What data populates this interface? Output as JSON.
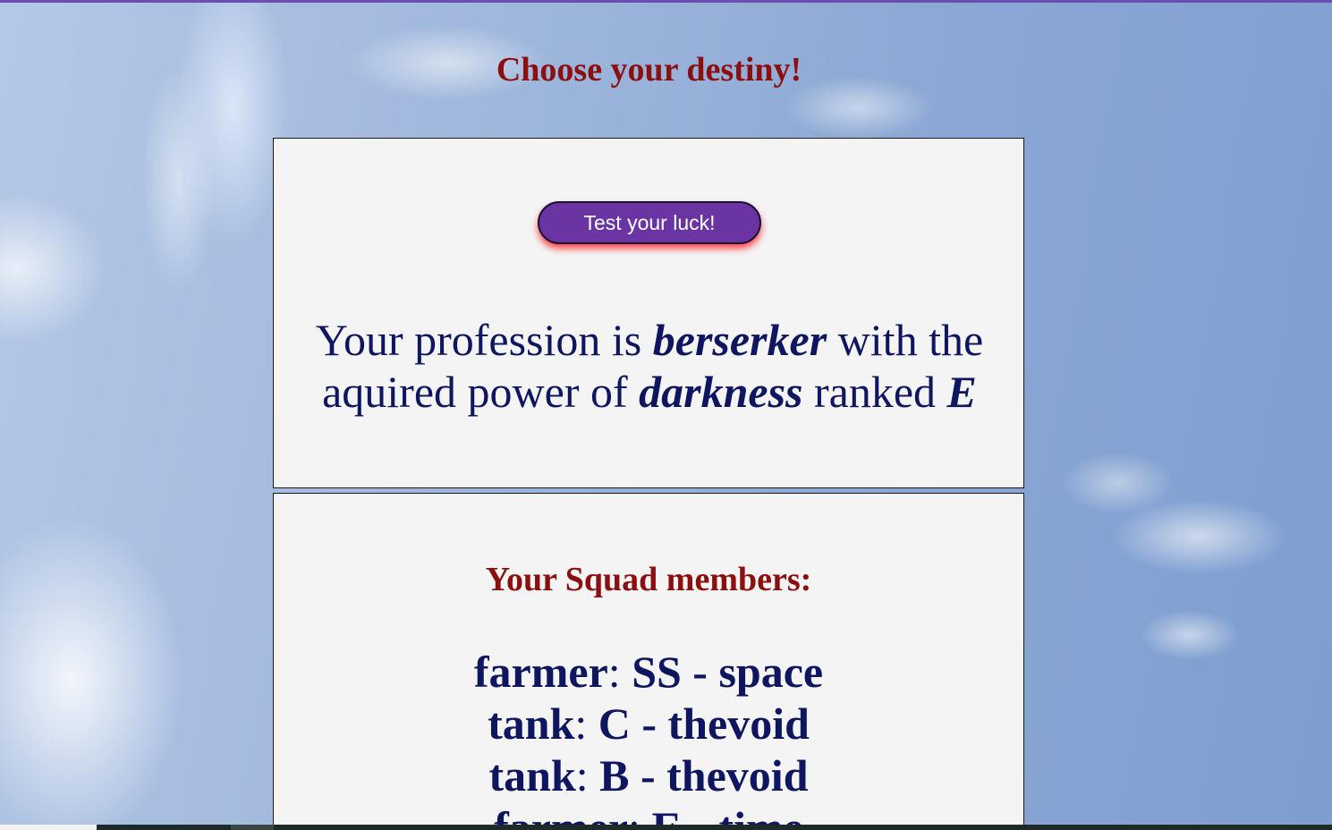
{
  "page": {
    "title": "Choose your destiny!"
  },
  "luck_panel": {
    "button_label": "Test your luck!",
    "result": {
      "prefix": "Your profession is ",
      "profession": "berserker",
      "middle": " with the aquired power of ",
      "power": "darkness",
      "rank_label": " ranked ",
      "rank": "E"
    }
  },
  "squad_panel": {
    "heading": "Your Squad members:",
    "members": [
      {
        "profession": "farmer",
        "separator": ": ",
        "detail": "SS - space"
      },
      {
        "profession": "tank",
        "separator": ": ",
        "detail": "C - thevoid"
      },
      {
        "profession": "tank",
        "separator": ": ",
        "detail": "B - thevoid"
      },
      {
        "profession": "farmer",
        "separator": ": ",
        "detail": "E - time"
      }
    ]
  },
  "colors": {
    "accent": "#6a35a3",
    "heading": "#8b0f0f",
    "body_text": "#0f1660",
    "panel_bg": "#f4f4f4"
  }
}
